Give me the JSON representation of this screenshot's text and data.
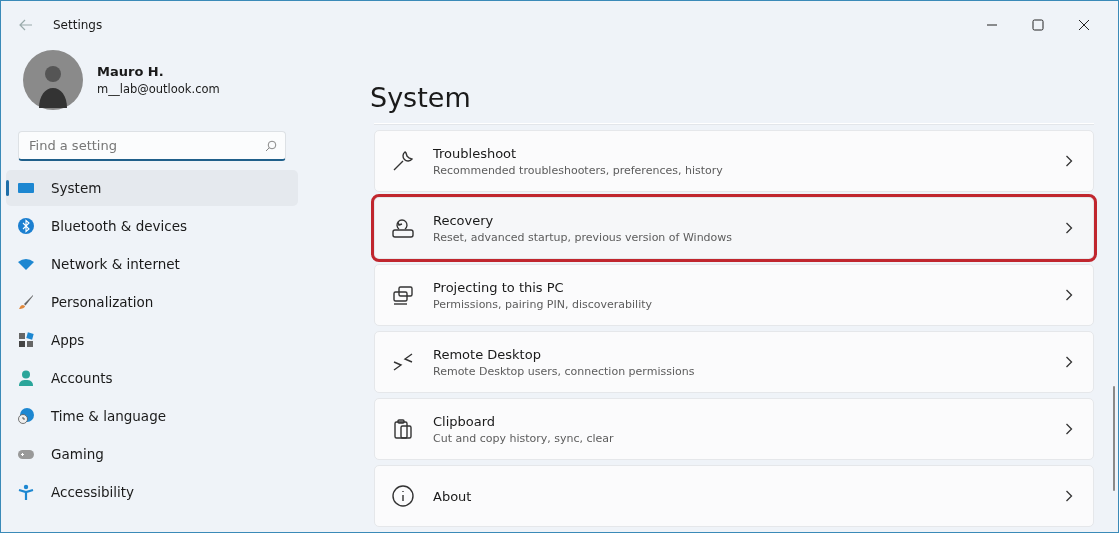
{
  "window": {
    "title": "Settings"
  },
  "account": {
    "name": "Mauro H.",
    "email": "m__lab@outlook.com"
  },
  "search": {
    "placeholder": "Find a setting"
  },
  "sidebar": {
    "items": [
      {
        "label": "System",
        "kind": "system",
        "selected": true
      },
      {
        "label": "Bluetooth & devices",
        "kind": "bluetooth",
        "selected": false
      },
      {
        "label": "Network & internet",
        "kind": "network",
        "selected": false
      },
      {
        "label": "Personalization",
        "kind": "personalization",
        "selected": false
      },
      {
        "label": "Apps",
        "kind": "apps",
        "selected": false
      },
      {
        "label": "Accounts",
        "kind": "accounts",
        "selected": false
      },
      {
        "label": "Time & language",
        "kind": "time",
        "selected": false
      },
      {
        "label": "Gaming",
        "kind": "gaming",
        "selected": false
      },
      {
        "label": "Accessibility",
        "kind": "accessibility",
        "selected": false
      }
    ]
  },
  "page": {
    "title": "System"
  },
  "cards": [
    {
      "kind": "troubleshoot",
      "title": "Troubleshoot",
      "subtitle": "Recommended troubleshooters, preferences, history",
      "highlighted": false
    },
    {
      "kind": "recovery",
      "title": "Recovery",
      "subtitle": "Reset, advanced startup, previous version of Windows",
      "highlighted": true
    },
    {
      "kind": "projecting",
      "title": "Projecting to this PC",
      "subtitle": "Permissions, pairing PIN, discoverability",
      "highlighted": false
    },
    {
      "kind": "remote",
      "title": "Remote Desktop",
      "subtitle": "Remote Desktop users, connection permissions",
      "highlighted": false
    },
    {
      "kind": "clipboard",
      "title": "Clipboard",
      "subtitle": "Cut and copy history, sync, clear",
      "highlighted": false
    },
    {
      "kind": "about",
      "title": "About",
      "highlighted": false
    }
  ]
}
